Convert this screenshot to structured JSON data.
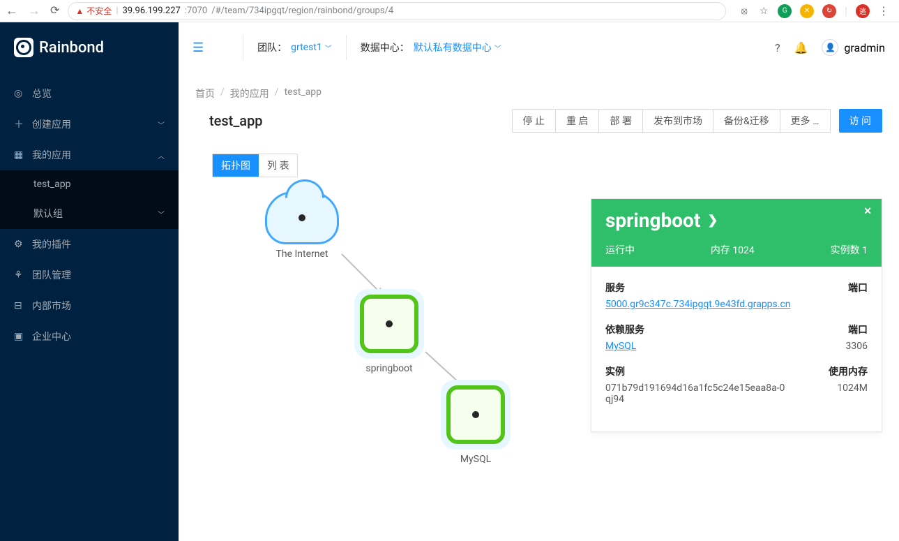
{
  "browser": {
    "url_host": "39.96.199.227",
    "url_port": ":7070",
    "url_path": "/#/team/734ipgqt/region/rainbond/groups/4",
    "insecure_label": "不安全"
  },
  "logo": "Rainbond",
  "sidebar": {
    "items": [
      {
        "label": "总览",
        "icon": "◎"
      },
      {
        "label": "创建应用",
        "icon": "+",
        "expandable": true
      },
      {
        "label": "我的应用",
        "icon": "▦",
        "expandable": true,
        "expanded": true
      },
      {
        "label": "test_app",
        "sub": true
      },
      {
        "label": "默认组",
        "sub": true,
        "expandable": true
      },
      {
        "label": "我的插件",
        "icon": "⚙"
      },
      {
        "label": "团队管理",
        "icon": "⚘"
      },
      {
        "label": "内部市场",
        "icon": "⊟"
      },
      {
        "label": "企业中心",
        "icon": "▣"
      }
    ]
  },
  "topbar": {
    "team_label": "团队：",
    "team_value": "grtest1",
    "dc_label": "数据中心：",
    "dc_value": "默认私有数据中心",
    "username": "gradmin"
  },
  "breadcrumb": {
    "home": "首页",
    "myapps": "我的应用",
    "current": "test_app"
  },
  "page": {
    "title": "test_app",
    "actions": {
      "stop": "停 止",
      "restart": "重 启",
      "deploy": "部 署",
      "publish": "发布到市场",
      "backup": "备份&迁移",
      "more": "更多  …",
      "visit": "访 问"
    },
    "tabs": {
      "topology": "拓扑图",
      "list": "列 表"
    }
  },
  "topology": {
    "internet": "The Internet",
    "springboot": "springboot",
    "mysql": "MySQL"
  },
  "detail": {
    "title": "springboot",
    "status": "运行中",
    "memory_label": "内存 1024",
    "instances_label": "实例数 1",
    "service_label": "服务",
    "port_label": "端口",
    "service_url": "5000.gr9c347c.734ipgqt.9e43fd.grapps.cn",
    "dep_label": "依赖服务",
    "dep_service": "MySQL",
    "dep_port": "3306",
    "instance_label": "实例",
    "mem_usage_label": "使用内存",
    "instance_id": "071b79d191694d16a1fc5c24e15eaa8a-0qj94",
    "mem_usage": "1024M"
  }
}
